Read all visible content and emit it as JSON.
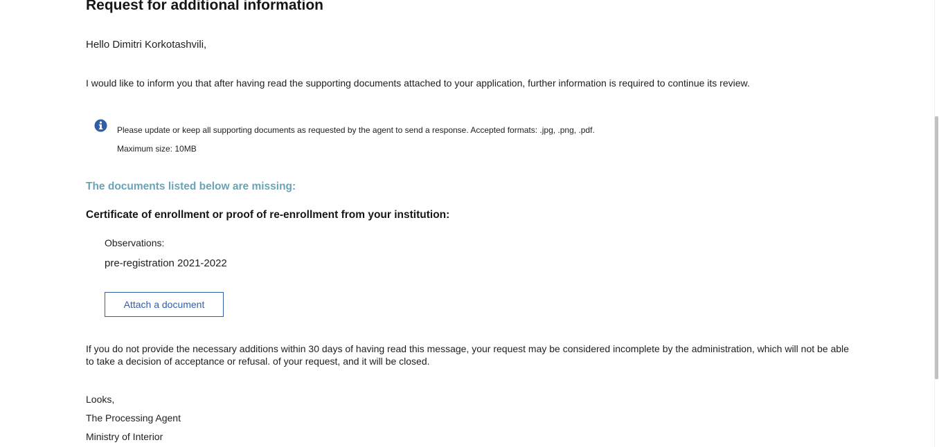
{
  "title": "Request for additional information",
  "greeting": "Hello Dimitri Korkotashvili,",
  "intro": "I would like to inform you that after having read the supporting documents attached to your application, further information is required to continue its review.",
  "info": {
    "icon": "info-icon",
    "icon_color": "#2f5fa8",
    "text": "Please update or keep all supporting documents as requested by the agent to send a response. Accepted formats: .jpg, .png, .pdf. Maximum size: 10MB"
  },
  "missing_heading": "The documents listed below are missing:",
  "missing_heading_color": "#6aa3b8",
  "document": {
    "title": "Certificate of enrollment or proof of re-enrollment from your institution:",
    "observations_label": "Observations:",
    "observations_value": "pre-registration 2021-2022",
    "attach_button": "Attach a document"
  },
  "warning": "If you do not provide the necessary additions within 30 days of having read this message, your request may be considered incomplete by the administration, which will not be able to take a decision of acceptance or refusal. of your request, and it will be closed.",
  "closing": {
    "line1": "Looks,",
    "line2": "The Processing Agent",
    "line3": "Ministry of Interior"
  },
  "accent_color": "#2f5fa8"
}
